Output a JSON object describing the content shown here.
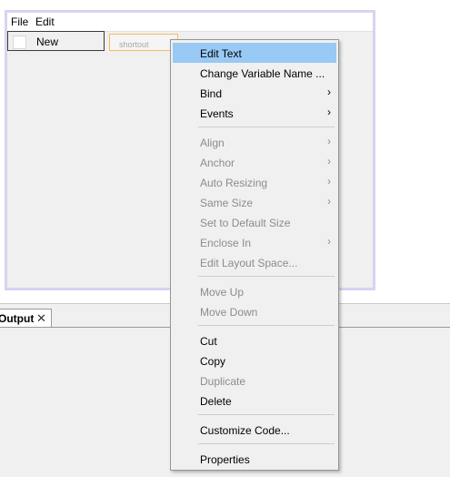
{
  "designer": {
    "menu_file": "File",
    "menu_edit": "Edit",
    "sub_item_label": "New",
    "shortcut_placeholder": "shortout"
  },
  "output": {
    "tab_label": "Output",
    "close_glyph": "✕"
  },
  "context_menu": {
    "items": [
      {
        "label": "Edit Text",
        "enabled": true,
        "submenu": false,
        "highlighted": true
      },
      {
        "label": "Change Variable Name ...",
        "enabled": true,
        "submenu": false
      },
      {
        "label": "Bind",
        "enabled": true,
        "submenu": true
      },
      {
        "label": "Events",
        "enabled": true,
        "submenu": true
      },
      {
        "label": "Align",
        "enabled": false,
        "submenu": true
      },
      {
        "label": "Anchor",
        "enabled": false,
        "submenu": true
      },
      {
        "label": "Auto Resizing",
        "enabled": false,
        "submenu": true
      },
      {
        "label": "Same Size",
        "enabled": false,
        "submenu": true
      },
      {
        "label": "Set to Default Size",
        "enabled": false,
        "submenu": false
      },
      {
        "label": "Enclose In",
        "enabled": false,
        "submenu": true
      },
      {
        "label": "Edit Layout Space...",
        "enabled": false,
        "submenu": false
      },
      {
        "label": "Move Up",
        "enabled": false,
        "submenu": false
      },
      {
        "label": "Move Down",
        "enabled": false,
        "submenu": false
      },
      {
        "label": "Cut",
        "enabled": true,
        "submenu": false
      },
      {
        "label": "Copy",
        "enabled": true,
        "submenu": false
      },
      {
        "label": "Duplicate",
        "enabled": false,
        "submenu": false
      },
      {
        "label": "Delete",
        "enabled": true,
        "submenu": false
      },
      {
        "label": "Customize Code...",
        "enabled": true,
        "submenu": false
      },
      {
        "label": "Properties",
        "enabled": true,
        "submenu": false
      }
    ],
    "arrow_glyph": "›"
  }
}
